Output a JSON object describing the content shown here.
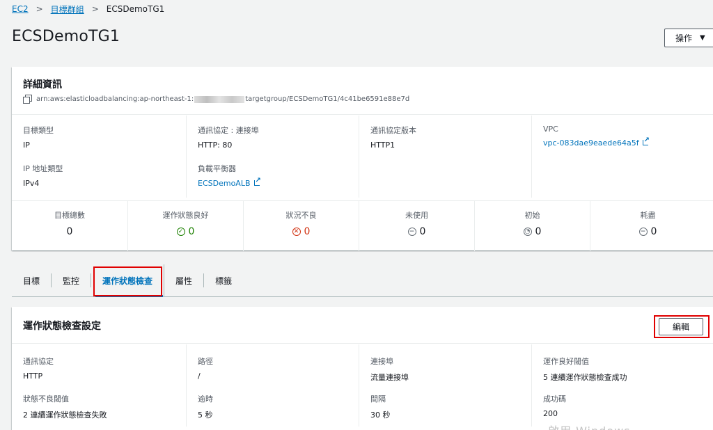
{
  "breadcrumb": {
    "root": "EC2",
    "parent": "目標群組",
    "current": "ECSDemoTG1",
    "sep": ">"
  },
  "page": {
    "title": "ECSDemoTG1",
    "actions_label": "操作",
    "actions_caret": "▼"
  },
  "details": {
    "title": "詳細資訊",
    "arn_prefix": "arn:aws:elasticloadbalancing:ap-northeast-1:",
    "arn_suffix": "targetgroup/ECSDemoTG1/4c41be6591e88e7d",
    "fields": {
      "target_type_label": "目標類型",
      "target_type_value": "IP",
      "protocol_port_label": "通訊協定 : 連接埠",
      "protocol_port_value": "HTTP: 80",
      "protocol_version_label": "通訊協定版本",
      "protocol_version_value": "HTTP1",
      "vpc_label": "VPC",
      "vpc_value": "vpc-083dae9eaede64a5f",
      "ip_type_label": "IP 地址類型",
      "ip_type_value": "IPv4",
      "lb_label": "負載平衡器",
      "lb_value": "ECSDemoALB"
    },
    "stats": [
      {
        "label": "目標總數",
        "value": "0",
        "status": "none"
      },
      {
        "label": "運作狀態良好",
        "value": "0",
        "status": "healthy"
      },
      {
        "label": "狀況不良",
        "value": "0",
        "status": "unhealthy"
      },
      {
        "label": "未使用",
        "value": "0",
        "status": "unused"
      },
      {
        "label": "初始",
        "value": "0",
        "status": "initial"
      },
      {
        "label": "耗盡",
        "value": "0",
        "status": "draining"
      }
    ]
  },
  "tabs": [
    "目標",
    "監控",
    "運作狀態檢查",
    "屬性",
    "標籤"
  ],
  "health_check": {
    "title": "運作狀態檢查設定",
    "edit_label": "編輯",
    "fields": {
      "protocol_label": "通訊協定",
      "protocol_value": "HTTP",
      "path_label": "路徑",
      "path_value": "/",
      "port_label": "連接埠",
      "port_value": "流量連接埠",
      "healthy_threshold_label": "運作良好閾值",
      "healthy_threshold_value": "5 連續運作狀態檢查成功",
      "unhealthy_threshold_label": "狀態不良閾值",
      "unhealthy_threshold_value": "2 連續運作狀態檢查失敗",
      "timeout_label": "逾時",
      "timeout_value": "5 秒",
      "interval_label": "間隔",
      "interval_value": "30 秒",
      "success_codes_label": "成功碼",
      "success_codes_value": "200"
    }
  },
  "watermark": "啟用 Windows",
  "colors": {
    "link": "#0073bb",
    "healthy": "#1d8102",
    "unhealthy": "#d13212",
    "highlight": "#e00000"
  }
}
